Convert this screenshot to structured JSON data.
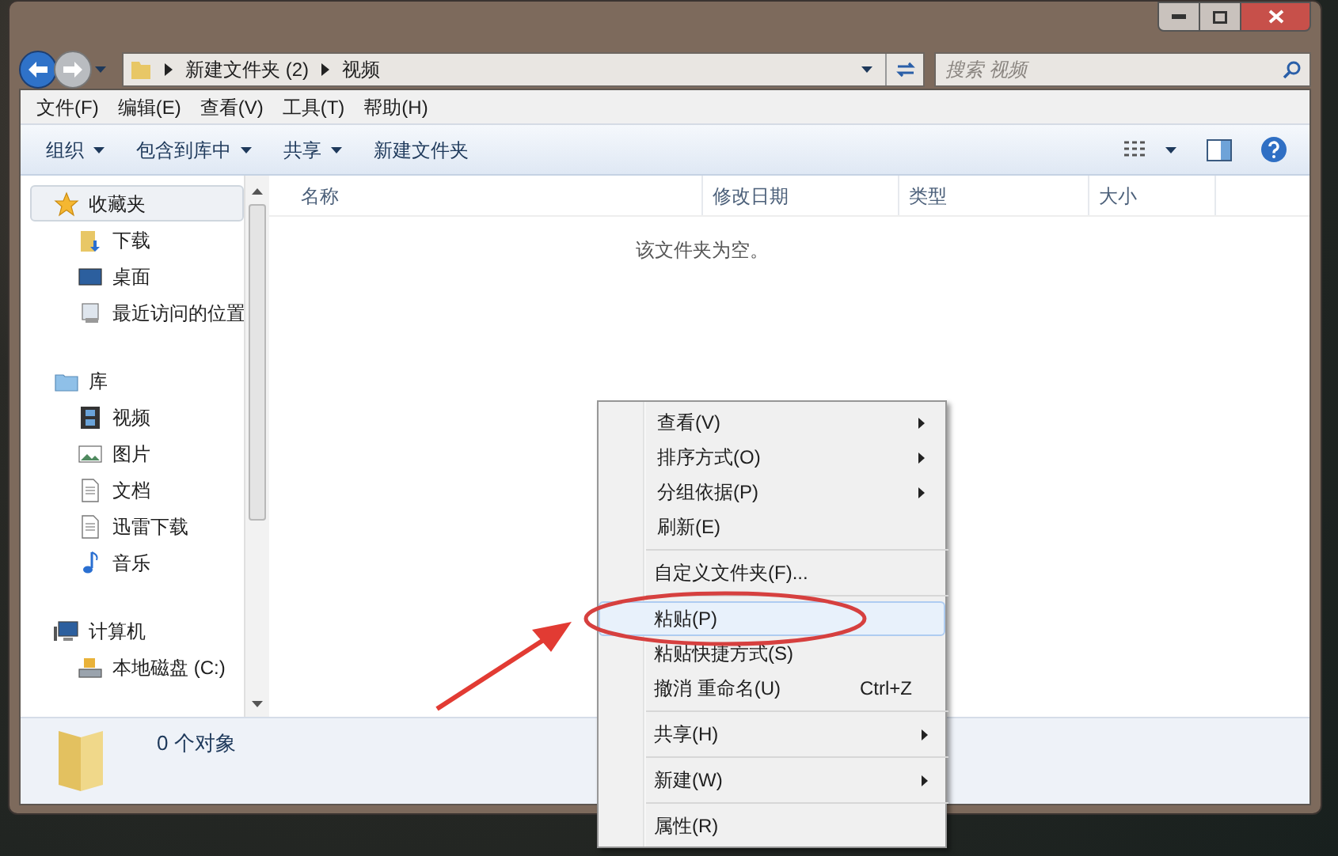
{
  "address": {
    "breadcrumbs": [
      "新建文件夹 (2)",
      "视频"
    ]
  },
  "search": {
    "placeholder": "搜索 视频"
  },
  "menu_bar": [
    "文件(F)",
    "编辑(E)",
    "查看(V)",
    "工具(T)",
    "帮助(H)"
  ],
  "toolbar": [
    {
      "label": "组织",
      "dropdown": true
    },
    {
      "label": "包含到库中",
      "dropdown": true
    },
    {
      "label": "共享",
      "dropdown": true
    },
    {
      "label": "新建文件夹",
      "dropdown": false
    }
  ],
  "columns": [
    "名称",
    "修改日期",
    "类型",
    "大小"
  ],
  "empty_message": "该文件夹为空。",
  "sidebar": [
    {
      "label": "收藏夹",
      "kind": "star",
      "selected": true,
      "children": [
        {
          "label": "下载",
          "kind": "download"
        },
        {
          "label": "桌面",
          "kind": "desktop"
        },
        {
          "label": "最近访问的位置",
          "kind": "recent"
        }
      ]
    },
    {
      "label": "库",
      "kind": "library",
      "selected": false,
      "children": [
        {
          "label": "视频",
          "kind": "video"
        },
        {
          "label": "图片",
          "kind": "picture"
        },
        {
          "label": "文档",
          "kind": "document"
        },
        {
          "label": "迅雷下载",
          "kind": "document"
        },
        {
          "label": "音乐",
          "kind": "music"
        }
      ]
    },
    {
      "label": "计算机",
      "kind": "computer",
      "selected": false,
      "children": [
        {
          "label": "本地磁盘 (C:)",
          "kind": "disk"
        }
      ]
    }
  ],
  "status": "0 个对象",
  "context_menu": [
    [
      {
        "label": "查看(V)",
        "submenu": true,
        "selected": false
      },
      {
        "label": "排序方式(O)",
        "submenu": true,
        "selected": false
      },
      {
        "label": "分组依据(P)",
        "submenu": true,
        "selected": false
      },
      {
        "label": "刷新(E)",
        "submenu": false,
        "selected": false
      }
    ],
    [
      {
        "label": "自定义文件夹(F)...",
        "submenu": false,
        "selected": false
      }
    ],
    [
      {
        "label": "粘贴(P)",
        "submenu": false,
        "selected": true
      },
      {
        "label": "粘贴快捷方式(S)",
        "submenu": false,
        "selected": false
      },
      {
        "label": "撤消 重命名(U)",
        "shortcut": "Ctrl+Z",
        "submenu": false,
        "selected": false
      }
    ],
    [
      {
        "label": "共享(H)",
        "submenu": true,
        "selected": false
      }
    ],
    [
      {
        "label": "新建(W)",
        "submenu": true,
        "selected": false
      }
    ],
    [
      {
        "label": "属性(R)",
        "submenu": false,
        "selected": false
      }
    ]
  ]
}
